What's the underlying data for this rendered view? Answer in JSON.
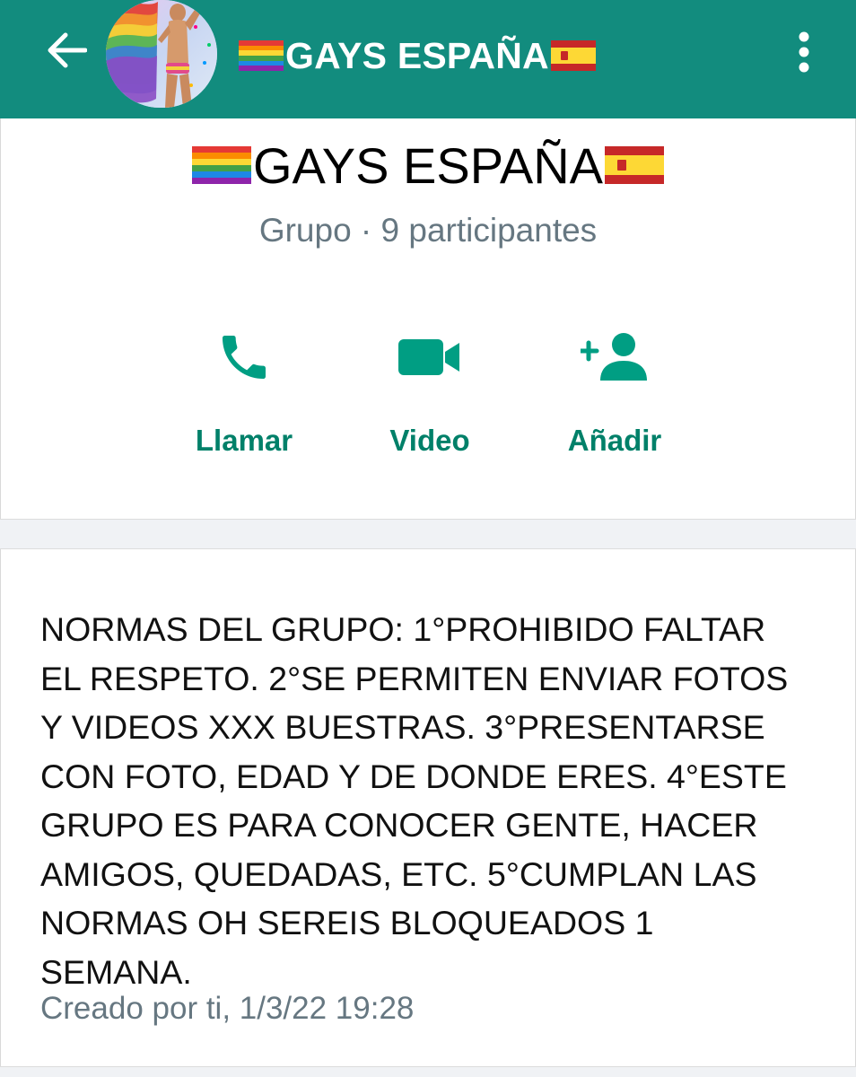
{
  "app_bar": {
    "title": "GAYS ESPAÑA",
    "back_icon": "arrow-left-icon",
    "menu_icon": "more-vertical-icon",
    "background_color": "#128c7e"
  },
  "group_info": {
    "name": "GAYS ESPAÑA",
    "subtitle": "Grupo · 9 participantes"
  },
  "actions": [
    {
      "label": "Llamar",
      "icon": "phone-icon"
    },
    {
      "label": "Video",
      "icon": "video-camera-icon"
    },
    {
      "label": "Añadir",
      "icon": "add-person-icon"
    }
  ],
  "description": {
    "text": "NORMAS DEL GRUPO: 1°PROHIBIDO FALTAR\nEL RESPETO. 2°SE PERMITEN ENVIAR FOTOS\nY VIDEOS XXX BUESTRAS. 3°PRESENTARSE\nCON FOTO, EDAD Y DE DONDE ERES. 4°ESTE\nGRUPO ES PARA CONOCER GENTE, HACER\nAMIGOS, QUEDADAS, ETC. 5°CUMPLAN LAS\nNORMAS OH SEREIS BLOQUEADOS 1\nSEMANA.",
    "meta": "Creado por ti, 1/3/22 19:28"
  },
  "colors": {
    "accent": "#008069",
    "header": "#128c7e",
    "secondary_text": "#667781"
  }
}
